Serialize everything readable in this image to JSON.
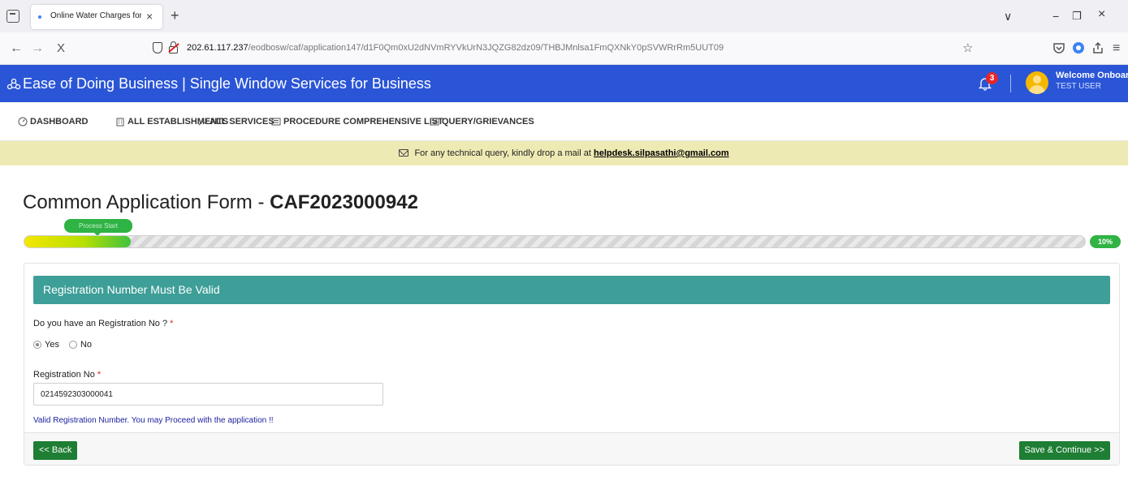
{
  "browser": {
    "tab_title": "Online Water Charges for Wate",
    "tab_close": "×",
    "new_tab": "+",
    "url_host": "202.61.117.237",
    "url_path": "/eodbosw/caf/application147/d1F0Qm0xU2dNVmRYVkUrN3JQZG82dz09/THBJMnlsa1FmQXNkY0pSVWRrRm5UUT09",
    "back": "←",
    "forward": "→",
    "stop": "X",
    "star": "☆",
    "win_dropdown": "∨",
    "win_minimize": "−",
    "win_restore": "❐",
    "win_close": "×",
    "menu": "≡"
  },
  "header": {
    "title": "Ease of Doing Business | Single Window Services for Business",
    "notification_count": "3",
    "welcome": "Welcome Onboard",
    "user": "TEST USER"
  },
  "menu": {
    "items": [
      {
        "label": "DASHBOARD",
        "icon": "gauge-icon"
      },
      {
        "label": "ALL ESTABLISHMENTS",
        "icon": "building-icon"
      },
      {
        "label": "ALL SERVICES",
        "icon": "wrench-icon"
      },
      {
        "label": "PROCEDURE COMPREHENSIVE LIST",
        "icon": "list-icon"
      },
      {
        "label": "QUERY/GRIEVANCES",
        "icon": "list-icon"
      }
    ]
  },
  "notice": {
    "text": "For any technical query, kindly drop a mail at",
    "email": "helpdesk.silpasathi@gmail.com"
  },
  "page": {
    "heading_prefix": "Common Application Form - ",
    "caf_number": "CAF2023000942"
  },
  "progress": {
    "tooltip": "Process Start",
    "percent_label": "10%",
    "fraction": 0.1
  },
  "form": {
    "section_title": "Registration Number Must Be Valid",
    "question": "Do you have an Registration No ?",
    "required_mark": "*",
    "options": [
      "Yes",
      "No"
    ],
    "selected": "Yes",
    "reg_label": "Registration No",
    "reg_value": "0214592303000041",
    "valid_message": "Valid Registration Number. You may Proceed with the application !!",
    "back_button": "<< Back",
    "save_button": "Save & Continue >>"
  },
  "colors": {
    "header_bg": "#2a55d6",
    "section_bg": "#3e9e98",
    "notice_bg": "#eeeab4",
    "button_green": "#1e7e34",
    "progress_green": "#2fb344"
  }
}
